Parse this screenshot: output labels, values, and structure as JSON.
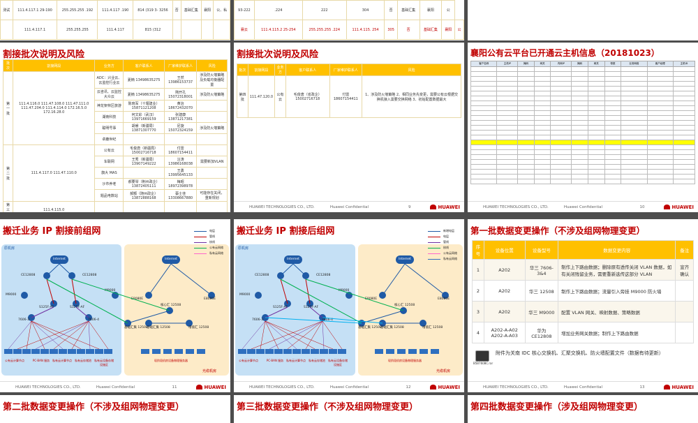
{
  "footer": {
    "company": "HUAWEI TECHNOLOGIES CO., LTD.",
    "conf": "Huawei Confidential",
    "brand": "HUAWEI"
  },
  "top_left": {
    "rows": [
      [
        "测试",
        "111.4.117.1 29-190",
        "255.255.255 .192",
        "111.4.117 .190",
        "814 (319 3- 3256",
        "否",
        "基础汇集",
        "襄阳",
        "公、私"
      ],
      [
        "",
        "111.4.117.1",
        "255.255.255",
        "111.4.117",
        "815 (312",
        "",
        "",
        "",
        ""
      ]
    ]
  },
  "top_mid": {
    "rows": [
      [
        "93-222",
        ".224",
        "222",
        "304",
        "否",
        "基础汇集",
        "襄阳",
        "公"
      ],
      [
        "襄云",
        "111.4.115.2 25-254",
        "255.255.255 .224",
        "111.4.115. 254",
        "305",
        "否",
        "基础汇集",
        "襄阳",
        "公"
      ]
    ]
  },
  "slide4": {
    "title": "割接批次说明及风险",
    "headers": [
      "批次",
      "割接网段",
      "业务方",
      "客户联系人",
      "厂家维护联系人",
      "风险"
    ],
    "batch1_label": "第一批",
    "batch1_ips": "111.4.116.0 111.47.108.0 111.47.111.0 111.47.204.0 111.4.114.0 172.16.5.0 172.16.28.0",
    "batch2_label": "第二批",
    "batch2_ips": "111.4.117.0 111.47.110.0",
    "batch3_label": "第三批",
    "batch3_ips": "111.4.115.0",
    "rows": [
      [
        "ADC：兴业云、云监控行业云",
        "夏楠 13498635275",
        "王然 13986153737",
        "涉及防火墙策略及负载均衡器配置"
      ],
      [
        "云咨讯、云监控大众云",
        "夏楠 13498635275",
        "隋开孔 15072318001",
        "涉及防火墙策略"
      ],
      [
        "神龙架林区旅游",
        "陈晓军（十堰建业）15871121208",
        "黄治 18672432070",
        ""
      ],
      [
        "湖南科技",
        "何文彩（武汉）13971669159",
        "张建康 13871217381",
        ""
      ],
      [
        "聪明号事",
        "胡睿（新疆局）13871307770",
        "尼旋 15072324159",
        "涉及防火墙策略"
      ],
      [
        "卓鹿世纪",
        "",
        "",
        ""
      ],
      [
        "公有云",
        "毛俊唐（新疆局）15002716718",
        "付雷 18607154411",
        ""
      ],
      [
        "车联网",
        "王秀（新疆局）13907149222",
        "汪涛 13986168038",
        "需要新加VLAN"
      ],
      [
        "旗大 MAS",
        "",
        "王勇 13995645133",
        ""
      ],
      [
        "沙市养老",
        "郝要琴（荆州政企）13872405111",
        "梅昭 18972398978",
        ""
      ],
      [
        "题品电数站",
        "郝额（随州政企）13872888168",
        "蔡士佳 13308667880",
        "可能存在关闭，重新规划"
      ]
    ]
  },
  "slide5": {
    "title": "割接批次说明及风险",
    "headers": [
      "批次",
      "割接网段",
      "业务方",
      "客户联系人",
      "厂家维护联系人",
      "风险"
    ],
    "row": [
      "第四批",
      "111.47.120.0",
      "公有云",
      "毛俊唐（省政企）15002716718",
      "付雷 18607154411",
      "1、涉及防火墙策略 2、相同业务先变更，需要公有云根据交换机接入需要交换网络 3、初始配置数据最大"
    ]
  },
  "slide6": {
    "title": "襄阳公有云平台已开通云主机信息（20181023）",
    "headers": [
      "客户名称",
      "主机IP",
      "掩码",
      "网关",
      "内网IP",
      "掩码",
      "网关",
      "带宽",
      "业务网络",
      "客户经理",
      "主机ID"
    ],
    "row_count": 24
  },
  "slide10": {
    "title": "搬迁业务 IP 割接前组网",
    "cloud_left": "原机房",
    "cloud_right": "光缆机房",
    "legend": [
      "电层",
      "管线",
      "核线",
      "公有云网络",
      "私有云网络"
    ],
    "nodes": [
      "Internet",
      "CE12808",
      "CE12808",
      "M9000",
      "M9000",
      "S125F-AF",
      "S125F-AF",
      "7606-3",
      "7606-4",
      "E8080E",
      "E8080E",
      "基础汇集 12508",
      "核心汇 12508",
      "基础汇集 12508",
      "增值汇 12508"
    ],
    "bottom": [
      "公有云计算节点",
      "PC-BAN 服务",
      "私有云计算节点",
      "私有云存储池",
      "私有云设备存储设施区",
      "现阶段机房设备物理服务器"
    ]
  },
  "slide11": {
    "title": "搬迁业务 IP 割接后组网",
    "cloud_left": "原机房",
    "cloud_right": "光缆机房",
    "legend": [
      "新增电层",
      "电层",
      "管线",
      "核线",
      "公有云网络",
      "私有云网络"
    ],
    "nodes": [
      "Internet",
      "CE12808",
      "CE12808",
      "M9000",
      "M9000",
      "S125F-AF",
      "S125F-AF",
      "7606-3",
      "7606-4",
      "E8080E",
      "E8080E",
      "基础汇集 12508",
      "核心汇 12508",
      "基础汇集 12508",
      "增值汇 12508"
    ],
    "bottom": [
      "公有云计算节点",
      "PC-BAN 服务",
      "私有云计算节点",
      "私有云存储池",
      "私有云设备存储设施区",
      "现阶段机房设备物理服务器"
    ]
  },
  "slide12": {
    "title": "第一批数据变更操作（不涉及组网物理变更）",
    "headers": [
      "序号",
      "设备位置",
      "设备型号",
      "数据变更内容",
      "备注"
    ],
    "rows": [
      [
        "1",
        "A202",
        "华三 7606-3&4",
        "制作上下路由数据；删除原有透传关闭 VLAN 数据，如有关闭残留业务，需要重新选传这部分 VLAN",
        "宣齐确认"
      ],
      [
        "2",
        "A202",
        "华三 12508",
        "制作上下路由数据；流量引入旁挂 M9000 防火墙",
        ""
      ],
      [
        "3",
        "A202",
        "华三 M9000",
        "配置 VLAN 网关、映射数据、策略数据",
        ""
      ],
      [
        "4",
        "A202-A-A02 A202-A-A03",
        "华为 CE12808",
        "增加业务网关数据；制作上下路由数据",
        ""
      ]
    ],
    "attachment_label": "B5B760BC.rar",
    "attachment_note": "附件为关南 IDC 核心交换机、汇聚交换机、防火墙配置文件（数据有待更新）"
  },
  "page_numbers": {
    "p9": "9",
    "p10": "10",
    "p11": "11",
    "p12": "12",
    "p13": "13"
  },
  "bottom_titles": [
    "第二批数据变更操作（不涉及组网物理变更）",
    "第三批数据变更操作（不涉及组网物理变更）",
    "第四批数据变更操作（涉及组网物理变更）"
  ],
  "colors": {
    "accent": "#c00000",
    "header": "#ffc000",
    "cloud": "#c5e0f5",
    "cloud2": "#fdebc8"
  }
}
